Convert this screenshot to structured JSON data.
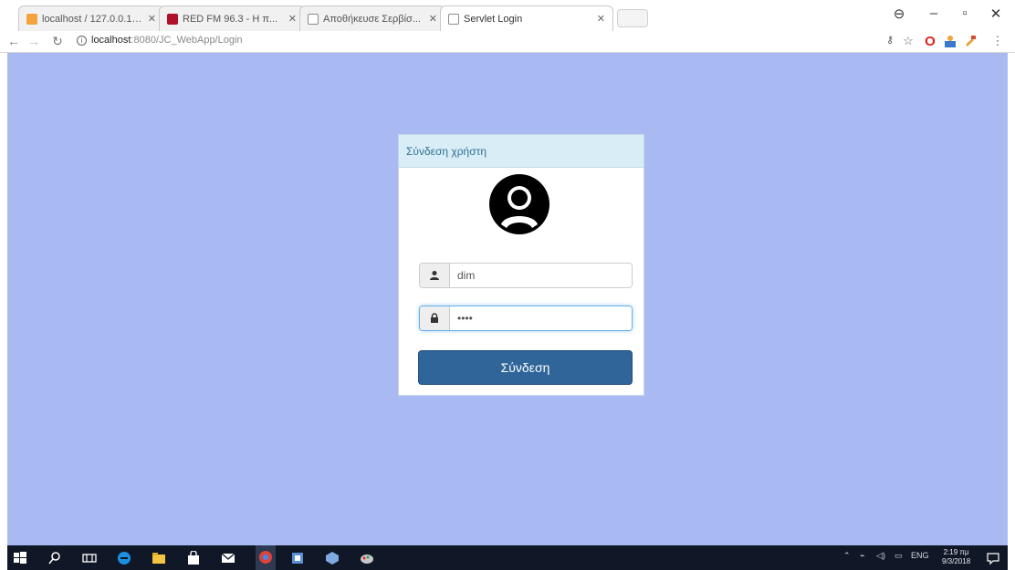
{
  "browser": {
    "tabs": [
      {
        "label": "localhost / 127.0.0.1 / ...",
        "active": false,
        "color": "#f3a33c"
      },
      {
        "label": "RED FM 96.3 - Η π...",
        "active": false,
        "color": "#b0102a"
      },
      {
        "label": "Αποθήκευσε Σερβίσ...",
        "active": false,
        "color": "#8a8a8a"
      },
      {
        "label": "Servlet Login",
        "active": true,
        "color": "#8a8a8a"
      }
    ],
    "address": {
      "host": "localhost",
      "path": ":8080/JC_WebApp/Login"
    }
  },
  "card": {
    "header": "Σύνδεση χρήστη",
    "username_value": "dim",
    "password_value": "••••",
    "submit_label": "Σύνδεση"
  },
  "taskbar": {
    "language": "ENG",
    "time": "2:19 πμ",
    "date": "9/3/2018"
  },
  "colors": {
    "page_background": "#a9baf2",
    "card_header": "#d9edf7",
    "button": "#2f6599"
  }
}
